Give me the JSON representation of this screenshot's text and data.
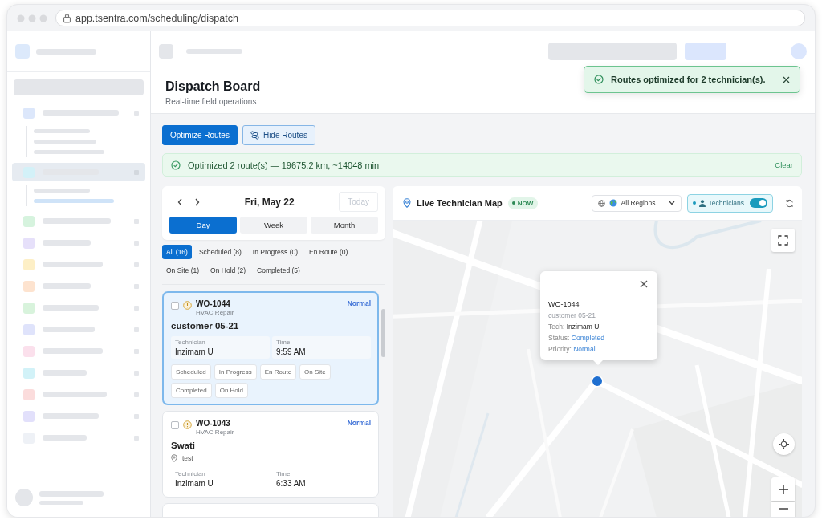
{
  "browser": {
    "url": "app.tsentra.com/scheduling/dispatch"
  },
  "sidebar": {
    "items": [
      {
        "color": "#dce7fb",
        "selected": false,
        "children": [
          {
            "selected": false
          },
          {
            "selected": false
          },
          {
            "selected": false
          }
        ]
      },
      {
        "color": "#d3f1f8",
        "selected": true,
        "children": [
          {
            "selected": false
          },
          {
            "selected": true
          }
        ]
      },
      {
        "color": "#d6f3de",
        "selected": false
      },
      {
        "color": "#e6e0fa",
        "selected": false
      },
      {
        "color": "#fdefc6",
        "selected": false
      },
      {
        "color": "#fde3cf",
        "selected": false
      },
      {
        "color": "#d8f3dc",
        "selected": false
      },
      {
        "color": "#dfe3fb",
        "selected": false
      },
      {
        "color": "#fbe0ec",
        "selected": false
      },
      {
        "color": "#d2f2f8",
        "selected": false
      },
      {
        "color": "#fbdcdc",
        "selected": false
      },
      {
        "color": "#e2e0fb",
        "selected": false
      },
      {
        "color": "#eef1f6",
        "selected": false
      }
    ]
  },
  "toast": {
    "message": "Routes optimized for 2 technician(s)."
  },
  "page": {
    "title": "Dispatch Board",
    "subtitle": "Real-time field operations"
  },
  "actions": [
    {
      "label": "Optimize Routes",
      "kind": "primary"
    },
    {
      "label": "Hide Routes",
      "kind": "secondary"
    }
  ],
  "banner": {
    "message": "Optimized 2 route(s) — 19675.2 km, ~14048 min",
    "action": "Clear"
  },
  "schedule": {
    "date": "Fri, May 22",
    "today": {
      "label": "Today",
      "disabled": true
    },
    "views": [
      {
        "label": "Day",
        "selected": true
      },
      {
        "label": "Week",
        "selected": false
      },
      {
        "label": "Month",
        "selected": false
      }
    ]
  },
  "filters": [
    {
      "label": "All (16)",
      "selected": true
    },
    {
      "label": "Scheduled (8)",
      "selected": false
    },
    {
      "label": "In Progress (0)",
      "selected": false
    },
    {
      "label": "En Route (0)",
      "selected": false
    },
    {
      "label": "On Site (1)",
      "selected": false
    },
    {
      "label": "On Hold (2)",
      "selected": false
    },
    {
      "label": "Completed (5)",
      "selected": false
    }
  ],
  "work_orders": [
    {
      "id": "WO-1044",
      "type": "HVAC Repair",
      "priority": "Normal",
      "customer": "customer 05-21",
      "checked": false,
      "selected": true,
      "fields": [
        {
          "label": "Technician",
          "value": "Inzimam U"
        },
        {
          "label": "Time",
          "value": "9:59 AM"
        }
      ],
      "statuses": [
        "Scheduled",
        "In Progress",
        "En Route",
        "On Site",
        "Completed",
        "On Hold"
      ]
    },
    {
      "id": "WO-1043",
      "type": "HVAC Repair",
      "priority": "Normal",
      "customer": "Swati",
      "location": "test",
      "checked": false,
      "selected": false,
      "fields": [
        {
          "label": "Technician",
          "value": "Inzimam U"
        },
        {
          "label": "Time",
          "value": "6:33 AM"
        }
      ]
    }
  ],
  "map": {
    "title": "Live Technician Map",
    "badge": "NOW",
    "region": "All Regions",
    "layer": {
      "label": "Technicians",
      "on": true
    },
    "popup": {
      "id": "WO-1044",
      "customer": "customer 05-21",
      "rows": [
        {
          "label": "Tech:",
          "value": "Inzimam U",
          "kind": "plain"
        },
        {
          "label": "Status:",
          "value": "Completed",
          "kind": "link"
        },
        {
          "label": "Priority:",
          "value": "Normal",
          "kind": "link"
        }
      ]
    }
  }
}
